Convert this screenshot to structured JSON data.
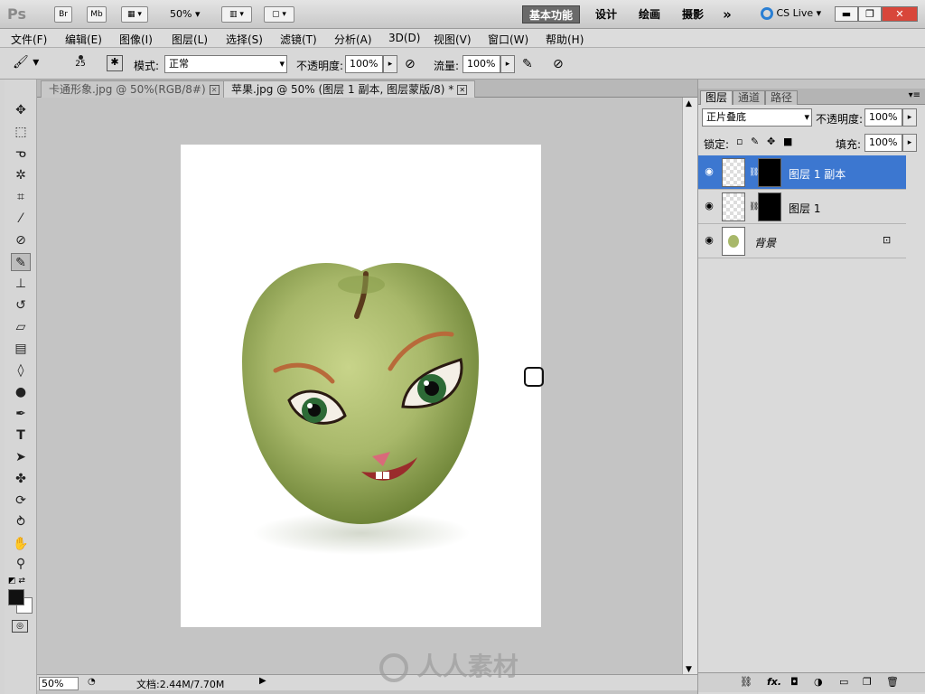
{
  "app": {
    "logo": "Ps",
    "bridge": "Br",
    "minibridge": "Mb",
    "zoom": "50%",
    "workspaces": [
      "基本功能",
      "设计",
      "绘画",
      "摄影"
    ],
    "more": "»",
    "cslive": "CS Live"
  },
  "menu": [
    "文件(F)",
    "编辑(E)",
    "图像(I)",
    "图层(L)",
    "选择(S)",
    "滤镜(T)",
    "分析(A)",
    "3D(D)",
    "视图(V)",
    "窗口(W)",
    "帮助(H)"
  ],
  "options": {
    "brush_size": "25",
    "mode_label": "模式:",
    "mode_value": "正常",
    "opacity_label": "不透明度:",
    "opacity_value": "100%",
    "flow_label": "流量:",
    "flow_value": "100%"
  },
  "tabs": [
    {
      "label": "卡通形象.jpg @ 50%(RGB/8#)",
      "close": "⊠"
    },
    {
      "label": "苹果.jpg @ 50% (图层 1 副本, 图层蒙版/8) *",
      "close": "⊠"
    }
  ],
  "status": {
    "zoom": "50%",
    "doc": "文档:2.44M/7.70M"
  },
  "layers_panel": {
    "tabs": [
      "图层",
      "通道",
      "路径"
    ],
    "blend_mode": "正片叠底",
    "opacity_label": "不透明度:",
    "opacity_value": "100%",
    "lock_label": "锁定:",
    "fill_label": "填充:",
    "fill_value": "100%",
    "layers": [
      {
        "name": "图层 1 副本",
        "selected": true
      },
      {
        "name": "图层 1",
        "selected": false
      },
      {
        "name": "背景",
        "selected": false
      }
    ],
    "bottom_icons": [
      "link-icon",
      "fx-icon",
      "mask-icon",
      "adjustment-icon",
      "folder-icon",
      "new-layer-icon",
      "trash-icon"
    ],
    "fx_label": "fx."
  },
  "watermark": "人人素材",
  "colors": {
    "selected_layer": "#3c77d0",
    "workspace_active": "#6a6a6a"
  }
}
